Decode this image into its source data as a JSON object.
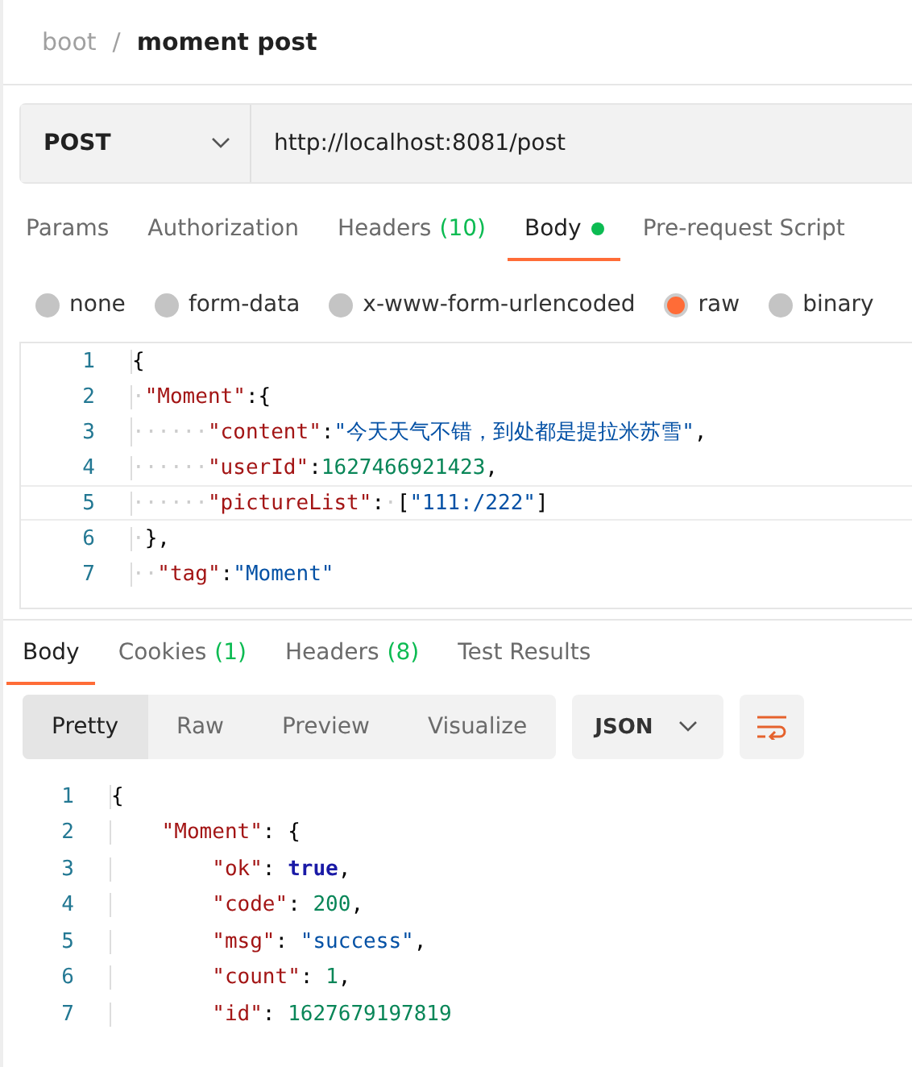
{
  "breadcrumb": {
    "parent": "boot",
    "separator": "/",
    "current": "moment post"
  },
  "request": {
    "method": "POST",
    "url": "http://localhost:8081/post"
  },
  "request_tabs": [
    {
      "label": "Params",
      "selected": false
    },
    {
      "label": "Authorization",
      "selected": false
    },
    {
      "label": "Headers",
      "count": "(10)",
      "selected": false
    },
    {
      "label": "Body",
      "selected": true,
      "dot": true
    },
    {
      "label": "Pre-request Script",
      "selected": false
    }
  ],
  "body_types": [
    {
      "label": "none",
      "selected": false
    },
    {
      "label": "form-data",
      "selected": false
    },
    {
      "label": "x-www-form-urlencoded",
      "selected": false
    },
    {
      "label": "raw",
      "selected": true
    },
    {
      "label": "binary",
      "selected": false
    }
  ],
  "request_body": [
    {
      "number": "1",
      "tokens": [
        {
          "kind": "punct",
          "text": "{"
        }
      ]
    },
    {
      "number": "2",
      "tokens": [
        {
          "kind": "ws",
          "text": "·"
        },
        {
          "kind": "key",
          "text": "\"Moment\""
        },
        {
          "kind": "punct",
          "text": ":{"
        }
      ]
    },
    {
      "number": "3",
      "tokens": [
        {
          "kind": "ws",
          "text": "······"
        },
        {
          "kind": "key",
          "text": "\"content\""
        },
        {
          "kind": "punct",
          "text": ":"
        },
        {
          "kind": "string",
          "text": "\"今天天气不错，到处都是提拉米苏雪\""
        },
        {
          "kind": "punct",
          "text": ","
        }
      ]
    },
    {
      "number": "4",
      "tokens": [
        {
          "kind": "ws",
          "text": "······"
        },
        {
          "kind": "key",
          "text": "\"userId\""
        },
        {
          "kind": "punct",
          "text": ":"
        },
        {
          "kind": "number",
          "text": "1627466921423"
        },
        {
          "kind": "punct",
          "text": ","
        }
      ]
    },
    {
      "number": "5",
      "tokens": [
        {
          "kind": "ws",
          "text": "······"
        },
        {
          "kind": "key",
          "text": "\"pictureList\""
        },
        {
          "kind": "punct",
          "text": ":"
        },
        {
          "kind": "ws",
          "text": "·"
        },
        {
          "kind": "punct",
          "text": "["
        },
        {
          "kind": "string",
          "text": "\"111:/222\""
        },
        {
          "kind": "punct",
          "text": "]"
        }
      ]
    },
    {
      "number": "6",
      "tokens": [
        {
          "kind": "ws",
          "text": "·"
        },
        {
          "kind": "punct",
          "text": "},"
        }
      ]
    },
    {
      "number": "7",
      "tokens": [
        {
          "kind": "ws",
          "text": "··"
        },
        {
          "kind": "key",
          "text": "\"tag\""
        },
        {
          "kind": "punct",
          "text": ":"
        },
        {
          "kind": "string",
          "text": "\"Moment\""
        }
      ]
    }
  ],
  "response_tabs": [
    {
      "label": "Body",
      "selected": true
    },
    {
      "label": "Cookies",
      "count": "(1)",
      "selected": false
    },
    {
      "label": "Headers",
      "count": "(8)",
      "selected": false
    },
    {
      "label": "Test Results",
      "selected": false
    }
  ],
  "view_modes": [
    {
      "label": "Pretty",
      "selected": true
    },
    {
      "label": "Raw",
      "selected": false
    },
    {
      "label": "Preview",
      "selected": false
    },
    {
      "label": "Visualize",
      "selected": false
    }
  ],
  "format": "JSON",
  "response_body": [
    {
      "number": "1",
      "tokens": [
        {
          "kind": "punct",
          "text": "{"
        }
      ]
    },
    {
      "number": "2",
      "tokens": [
        {
          "kind": "key",
          "text": "    \"Moment\""
        },
        {
          "kind": "punct",
          "text": ": {"
        }
      ]
    },
    {
      "number": "3",
      "tokens": [
        {
          "kind": "key",
          "text": "        \"ok\""
        },
        {
          "kind": "punct",
          "text": ": "
        },
        {
          "kind": "keyword",
          "text": "true"
        },
        {
          "kind": "punct",
          "text": ","
        }
      ]
    },
    {
      "number": "4",
      "tokens": [
        {
          "kind": "key",
          "text": "        \"code\""
        },
        {
          "kind": "punct",
          "text": ": "
        },
        {
          "kind": "number",
          "text": "200"
        },
        {
          "kind": "punct",
          "text": ","
        }
      ]
    },
    {
      "number": "5",
      "tokens": [
        {
          "kind": "key",
          "text": "        \"msg\""
        },
        {
          "kind": "punct",
          "text": ": "
        },
        {
          "kind": "string",
          "text": "\"success\""
        },
        {
          "kind": "punct",
          "text": ","
        }
      ]
    },
    {
      "number": "6",
      "tokens": [
        {
          "kind": "key",
          "text": "        \"count\""
        },
        {
          "kind": "punct",
          "text": ": "
        },
        {
          "kind": "number",
          "text": "1"
        },
        {
          "kind": "punct",
          "text": ","
        }
      ]
    },
    {
      "number": "7",
      "tokens": [
        {
          "kind": "key",
          "text": "        \"id\""
        },
        {
          "kind": "punct",
          "text": ": "
        },
        {
          "kind": "number",
          "text": "1627679197819"
        }
      ]
    }
  ]
}
